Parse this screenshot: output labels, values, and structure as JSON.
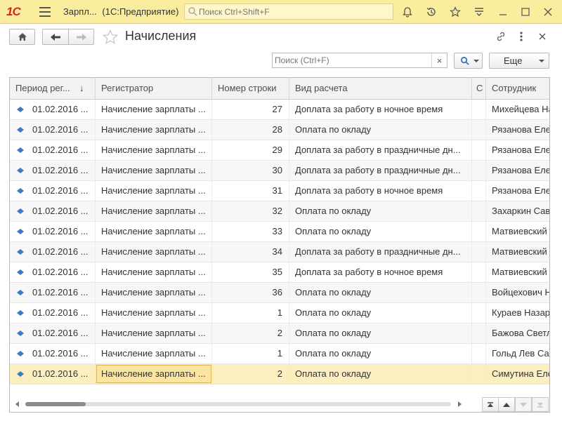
{
  "app": {
    "logo": "1С",
    "title": "Зарпл...",
    "platform": "(1С:Предприятие)",
    "search_placeholder": "Поиск Ctrl+Shift+F"
  },
  "form": {
    "title": "Начисления",
    "search_placeholder": "Поиск (Ctrl+F)",
    "clear_symbol": "×",
    "more_label": "Еще"
  },
  "columns": [
    {
      "label": "Период рег..."
    },
    {
      "label": "Регистратор"
    },
    {
      "label": "Номер строки"
    },
    {
      "label": "Вид расчета"
    },
    {
      "label": "С"
    },
    {
      "label": "Сотрудник"
    }
  ],
  "sort_indicator": "↓",
  "rows": [
    {
      "period": "01.02.2016 ...",
      "registrar": "Начисление зарплаты ...",
      "line": "27",
      "kind": "Доплата за работу в ночное время",
      "employee": "Михейцева На"
    },
    {
      "period": "01.02.2016 ...",
      "registrar": "Начисление зарплаты ...",
      "line": "28",
      "kind": "Оплата по окладу",
      "employee": "Рязанова Еле"
    },
    {
      "period": "01.02.2016 ...",
      "registrar": "Начисление зарплаты ...",
      "line": "29",
      "kind": "Доплата за работу в праздничные дн...",
      "employee": "Рязанова Еле"
    },
    {
      "period": "01.02.2016 ...",
      "registrar": "Начисление зарплаты ...",
      "line": "30",
      "kind": "Доплата за работу в праздничные дн...",
      "employee": "Рязанова Еле"
    },
    {
      "period": "01.02.2016 ...",
      "registrar": "Начисление зарплаты ...",
      "line": "31",
      "kind": "Доплата за работу в ночное время",
      "employee": "Рязанова Еле"
    },
    {
      "period": "01.02.2016 ...",
      "registrar": "Начисление зарплаты ...",
      "line": "32",
      "kind": "Оплата по окладу",
      "employee": "Захаркин Сав"
    },
    {
      "period": "01.02.2016 ...",
      "registrar": "Начисление зарплаты ...",
      "line": "33",
      "kind": "Оплата по окладу",
      "employee": "Матвиевский"
    },
    {
      "period": "01.02.2016 ...",
      "registrar": "Начисление зарплаты ...",
      "line": "34",
      "kind": "Доплата за работу в праздничные дн...",
      "employee": "Матвиевский"
    },
    {
      "period": "01.02.2016 ...",
      "registrar": "Начисление зарплаты ...",
      "line": "35",
      "kind": "Доплата за работу в ночное время",
      "employee": "Матвиевский"
    },
    {
      "period": "01.02.2016 ...",
      "registrar": "Начисление зарплаты ...",
      "line": "36",
      "kind": "Оплата по окладу",
      "employee": "Войцехович Н"
    },
    {
      "period": "01.02.2016 ...",
      "registrar": "Начисление зарплаты ...",
      "line": "1",
      "kind": "Оплата по окладу",
      "employee": "Кураев Назар"
    },
    {
      "period": "01.02.2016 ...",
      "registrar": "Начисление зарплаты ...",
      "line": "2",
      "kind": "Оплата по окладу",
      "employee": "Бажова Светл"
    },
    {
      "period": "01.02.2016 ...",
      "registrar": "Начисление зарплаты ...",
      "line": "1",
      "kind": "Оплата по окладу",
      "employee": "Гольд Лев Са"
    },
    {
      "period": "01.02.2016 ...",
      "registrar": "Начисление зарплаты ...",
      "line": "2",
      "kind": "Оплата по окладу",
      "employee": "Симутина Еле"
    }
  ],
  "selected_row_index": 13,
  "colors": {
    "titlebar": "#fbed9e",
    "selected_row": "#fbefbf",
    "logo_red": "#dd2222",
    "row_icon": "#3a7cc4"
  }
}
